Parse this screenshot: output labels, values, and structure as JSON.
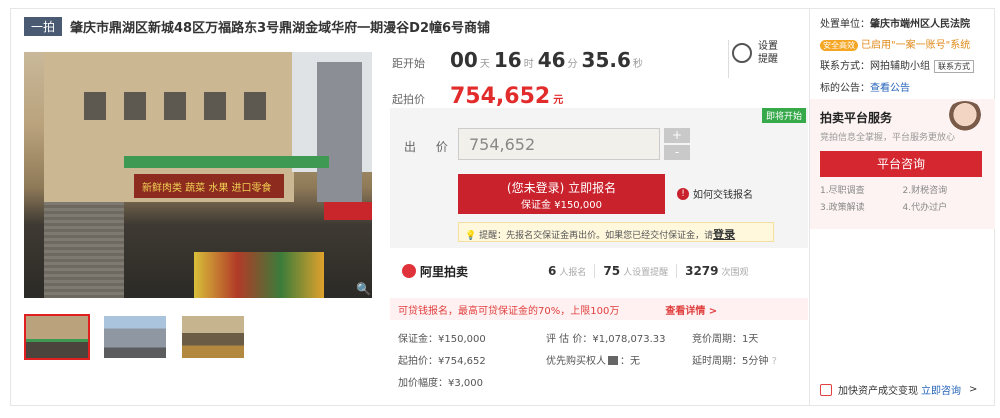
{
  "title": {
    "tag": "一拍",
    "text": "肇庆市鼎湖区新城48区万福路东3号鼎湖金域华府一期漫谷D2幢6号商铺"
  },
  "photo": {
    "sign_text": "新鲜肉类 蔬菜 水果 进口零食"
  },
  "countdown": {
    "label": "距开始",
    "days": "00",
    "days_unit": "天",
    "hours": "16",
    "hours_unit": "时",
    "minutes": "46",
    "minutes_unit": "分",
    "seconds": "35.6",
    "seconds_unit": "秒"
  },
  "reminder": {
    "line1": "设置",
    "line2": "提醒"
  },
  "start_price": {
    "label": "起拍价",
    "value": "754,652",
    "unit": "元"
  },
  "bid": {
    "status_badge": "即将开始",
    "label": "出 价",
    "input_value": "754,652",
    "plus": "+",
    "minus": "-",
    "register_line1": "(您未登录) 立即报名",
    "register_line2": "保证金 ¥150,000",
    "how_to_pay": "如何交钱报名",
    "tip_text": "提醒：先报名交保证金再出价。如果您已经交付保证金，请",
    "tip_login": "登录"
  },
  "stats": {
    "brand": "阿里拍卖",
    "signups": "6",
    "signups_unit": "人报名",
    "reminders": "75",
    "reminders_unit": "人设置提醒",
    "views": "3279",
    "views_unit": "次围观"
  },
  "loan": {
    "text": "可贷钱报名，最高可贷保证金的70%，上限100万",
    "link": "查看详情 >"
  },
  "details": {
    "deposit": "保证金：¥150,000",
    "appraisal": "评 估 价：¥1,078,073.33",
    "cycle": "竞价周期：1天",
    "start": "起拍价：¥754,652",
    "priority": "优先购买权人",
    "priority_value": "：无",
    "delay": "延时周期：5分钟",
    "increment": "加价幅度：¥3,000"
  },
  "right": {
    "unit_label": "处置单位：",
    "court": "肇庆市端州区人民法院",
    "safe_badge": "安全高效",
    "safe_text": "已启用\"一案一账号\"系统",
    "contact_label": "联系方式：",
    "contact_value": "网拍辅助小组",
    "contact_btn": "联系方式",
    "notice_label": "标的公告：",
    "notice_link": "查看公告",
    "service_title": "拍卖平台服务",
    "service_sub": "竞拍信息全掌握，平台服务更放心",
    "consult_button": "平台咨询",
    "services": [
      "1.尽职调查",
      "2.财税咨询",
      "3.政策解读",
      "4.代办过户"
    ],
    "bottom_text": "加快资产成交变现",
    "bottom_link": "立即咨询",
    "bottom_arrow": ">"
  }
}
